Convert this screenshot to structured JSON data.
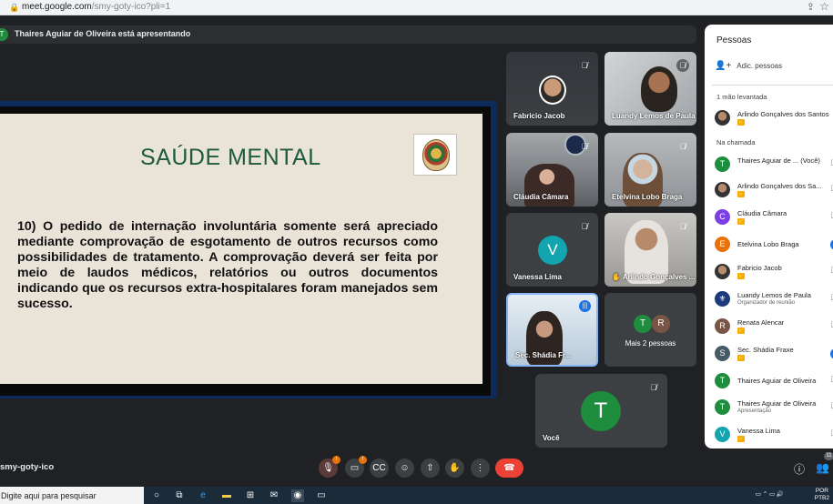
{
  "browser": {
    "url_host": "meet.google.com",
    "url_path": "/smy-goty-ico?pli=1"
  },
  "presenting": {
    "initial": "T",
    "text": "Thaires Aguiar de Oliveira está apresentando"
  },
  "slide": {
    "title": "SAÚDE MENTAL",
    "body": "10) O pedido de internação involuntária somente será apreciado mediante comprovação de esgotamento de outros recursos como possibilidades de tratamento. A comprovação deverá ser feita por meio de laudos médicos, relatórios ou outros documentos indicando que os recursos extra-hospitalares foram manejados sem sucesso."
  },
  "tiles": {
    "fabricio": "Fabricio Jacob",
    "luandy": "Luandy Lemos de Paula",
    "claudia": "Cláudia Câmara",
    "etelvina": "Etelvina Lobo Braga",
    "vanessa": "Vanessa Lima",
    "vanessa_initial": "V",
    "arlindo": "Arlindo Gonçalves ...",
    "shadia": "Sec. Shádia Fr...",
    "more_label": "Mais 2 pessoas",
    "more_initial_1": "T",
    "more_initial_2": "R",
    "voce": "Você",
    "voce_initial": "T"
  },
  "panel": {
    "title": "Pessoas",
    "add_label": "Adic. pessoas",
    "raised_header": "1 mão levantada",
    "raised": [
      {
        "name": "Arlindo Gonçalves dos Santos"
      }
    ],
    "in_call_header": "Na chamada",
    "people": [
      {
        "initial": "T",
        "name": "Thaires Aguiar de ...",
        "suffix": "(Você)",
        "color": "#1e8e3e"
      },
      {
        "initial": "",
        "name": "Arlindo Gonçalves dos Sa...",
        "color": ""
      },
      {
        "initial": "C",
        "name": "Cláudia Câmara",
        "color": "#7b3fe4"
      },
      {
        "initial": "E",
        "name": "Etelvina Lobo Braga",
        "color": "#e8710a"
      },
      {
        "initial": "",
        "name": "Fabricio Jacob",
        "color": ""
      },
      {
        "initial": "",
        "name": "Luandy Lemos de Paula",
        "sub": "Organizador de reunião",
        "color": ""
      },
      {
        "initial": "R",
        "name": "Renata Alencar",
        "color": "#795548"
      },
      {
        "initial": "S",
        "name": "Sec. Shádia Fraxe",
        "color": "#455a64"
      },
      {
        "initial": "T",
        "name": "Thaires Aguiar de Oliveira",
        "color": "#1e8e3e"
      },
      {
        "initial": "T",
        "name": "Thaires Aguiar de Oliveira",
        "sub": "Apresentação",
        "color": "#1e8e3e"
      },
      {
        "initial": "V",
        "name": "Vanessa Lima",
        "color": "#12a4af"
      }
    ]
  },
  "bottom": {
    "meeting_code": "smy-goty-ico",
    "mic_badge": "!",
    "cam_badge": "!",
    "people_count": "11"
  },
  "taskbar": {
    "search_placeholder": "Digite aqui para pesquisar",
    "lang": "POR",
    "layout": "PTB2"
  },
  "colors": {
    "meet_bg": "#202124",
    "tile_bg": "#3c4043",
    "end_call": "#ea4335",
    "accent_blue": "#1a73e8",
    "slide_title": "#1e5a3c"
  }
}
